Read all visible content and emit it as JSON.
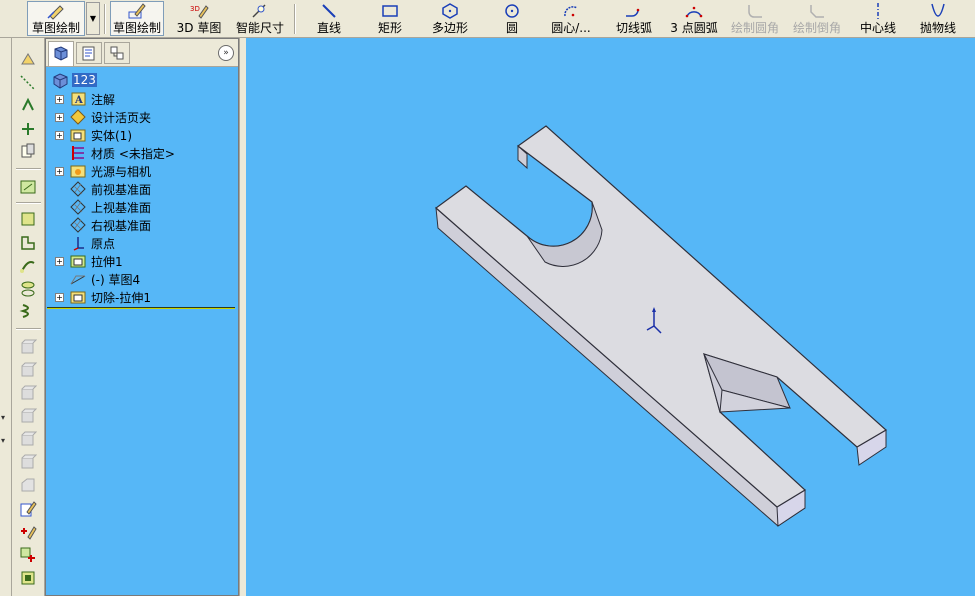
{
  "toolbar": {
    "sketch_dropdown": "草图绘制",
    "sketch": "草图绘制",
    "sketch_3d": "3D 草图",
    "smart_dim": "智能尺寸",
    "line": "直线",
    "rectangle": "矩形",
    "polygon": "多边形",
    "circle": "圆",
    "center_arc": "圆心/...",
    "tangent_arc": "切线弧",
    "three_point_arc": "3 点圆弧",
    "fillet": "绘制圆角",
    "chamfer": "绘制倒角",
    "centerline": "中心线",
    "parabola": "抛物线"
  },
  "feature_tree": {
    "root": "123",
    "items": [
      {
        "label": "注解",
        "icon": "annotation-icon",
        "expandable": true
      },
      {
        "label": "设计活页夹",
        "icon": "design-binder-icon",
        "expandable": true
      },
      {
        "label": "实体(1)",
        "icon": "solid-body-icon",
        "expandable": true
      },
      {
        "label": "材质 <未指定>",
        "icon": "material-icon",
        "expandable": false
      },
      {
        "label": "光源与相机",
        "icon": "lights-cameras-icon",
        "expandable": true
      },
      {
        "label": "前视基准面",
        "icon": "plane-icon",
        "expandable": false
      },
      {
        "label": "上视基准面",
        "icon": "plane-icon",
        "expandable": false
      },
      {
        "label": "右视基准面",
        "icon": "plane-icon",
        "expandable": false
      },
      {
        "label": "原点",
        "icon": "origin-icon",
        "expandable": false
      },
      {
        "label": "拉伸1",
        "icon": "extrude-icon",
        "expandable": true
      },
      {
        "label": "(-) 草图4",
        "icon": "sketch-icon",
        "expandable": false
      },
      {
        "label": "切除-拉伸1",
        "icon": "cut-extrude-icon",
        "expandable": true
      }
    ]
  },
  "colors": {
    "viewport_bg": "#56b7f7",
    "part_top": "#dcdce1",
    "part_side": "#c9c9d3",
    "part_edge": "#2f2f3a"
  }
}
